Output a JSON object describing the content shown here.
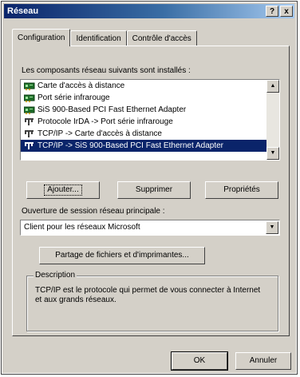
{
  "window": {
    "title": "Réseau",
    "help_glyph": "?",
    "close_glyph": "x"
  },
  "tabs": [
    {
      "label": "Configuration",
      "active": true
    },
    {
      "label": "Identification",
      "active": false
    },
    {
      "label": "Contrôle d'accès",
      "active": false
    }
  ],
  "components": {
    "label": "Les composants réseau suivants sont installés :",
    "items": [
      {
        "label": "Carte d'accès à distance",
        "icon": "network-adapter-icon",
        "selected": false
      },
      {
        "label": "Port série infrarouge",
        "icon": "network-adapter-icon",
        "selected": false
      },
      {
        "label": "SiS 900-Based PCI Fast Ethernet Adapter",
        "icon": "network-adapter-icon",
        "selected": false
      },
      {
        "label": "Protocole IrDA -> Port série infrarouge",
        "icon": "protocol-icon",
        "selected": false
      },
      {
        "label": "TCP/IP -> Carte d'accès à distance",
        "icon": "protocol-icon",
        "selected": false
      },
      {
        "label": "TCP/IP -> SiS 900-Based PCI Fast Ethernet Adapter",
        "icon": "protocol-icon",
        "selected": true
      }
    ]
  },
  "buttons": {
    "add": "Ajouter...",
    "remove": "Supprimer",
    "properties": "Propriétés",
    "sharing": "Partage de fichiers et d'imprimantes...",
    "ok": "OK",
    "cancel": "Annuler"
  },
  "logon": {
    "label": "Ouverture de session réseau principale :",
    "selected": "Client pour les réseaux Microsoft"
  },
  "description": {
    "title": "Description",
    "text": "TCP/IP est le protocole qui permet de vous connecter à Internet et aux grands réseaux."
  },
  "colors": {
    "face": "#d4d0c8",
    "selection": "#0a246a",
    "title_gradient_start": "#0a246a",
    "title_gradient_end": "#a6caf0"
  }
}
